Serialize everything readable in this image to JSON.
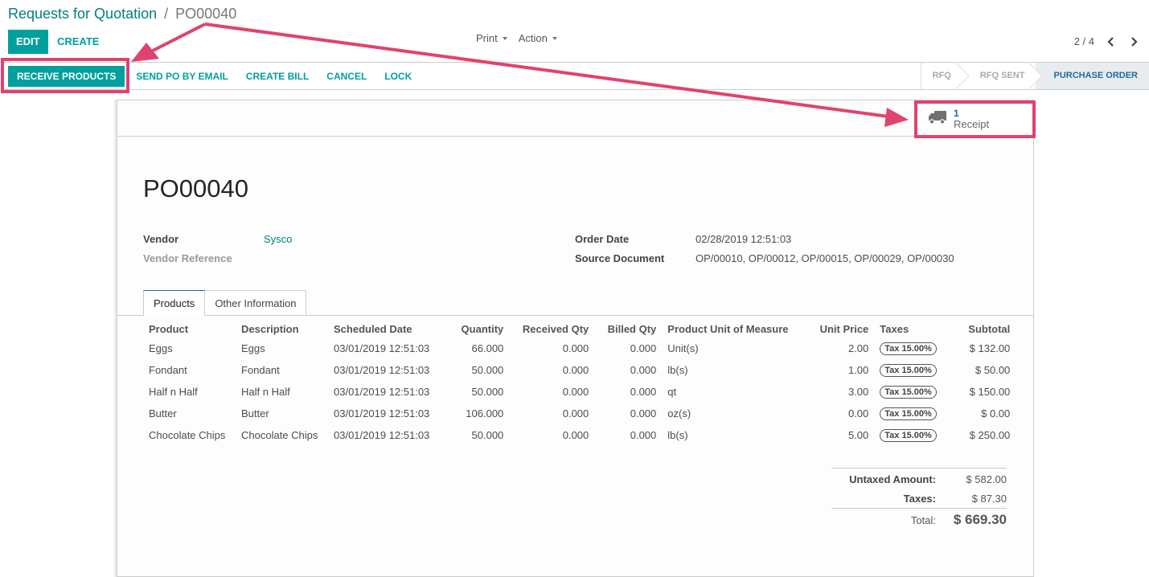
{
  "breadcrumb": {
    "parent": "Requests for Quotation",
    "separator": "/",
    "current": "PO00040"
  },
  "control_panel": {
    "edit_label": "EDIT",
    "create_label": "CREATE",
    "print_label": "Print",
    "action_label": "Action",
    "pager": {
      "value": "2 / 4"
    }
  },
  "statusbar": {
    "buttons": [
      "RECEIVE PRODUCTS",
      "SEND PO BY EMAIL",
      "CREATE BILL",
      "CANCEL",
      "LOCK"
    ],
    "stages": [
      {
        "label": "RFQ",
        "active": false
      },
      {
        "label": "RFQ SENT",
        "active": false
      },
      {
        "label": "PURCHASE ORDER",
        "active": true
      }
    ]
  },
  "smart_button": {
    "icon": "truck-icon",
    "count": "1",
    "label": "Receipt"
  },
  "form": {
    "title": "PO00040",
    "left_fields": [
      {
        "label": "Vendor",
        "value": "Sysco"
      },
      {
        "label": "Vendor Reference",
        "value": ""
      }
    ],
    "right_fields": [
      {
        "label": "Order Date",
        "value": "02/28/2019 12:51:03"
      },
      {
        "label": "Source Document",
        "value": "OP/00010, OP/00012, OP/00015, OP/00029, OP/00030"
      }
    ],
    "tabs": [
      "Products",
      "Other Information"
    ]
  },
  "lines": {
    "headers": [
      "Product",
      "Description",
      "Scheduled Date",
      "Quantity",
      "Received Qty",
      "Billed Qty",
      "Product Unit of Measure",
      "Unit Price",
      "Taxes",
      "Subtotal"
    ],
    "rows": [
      [
        "Eggs",
        "Eggs",
        "03/01/2019 12:51:03",
        "66.000",
        "0.000",
        "0.000",
        "Unit(s)",
        "2.00",
        "Tax 15.00%",
        "$ 132.00"
      ],
      [
        "Fondant",
        "Fondant",
        "03/01/2019 12:51:03",
        "50.000",
        "0.000",
        "0.000",
        "lb(s)",
        "1.00",
        "Tax 15.00%",
        "$ 50.00"
      ],
      [
        "Half n Half",
        "Half n Half",
        "03/01/2019 12:51:03",
        "50.000",
        "0.000",
        "0.000",
        "qt",
        "3.00",
        "Tax 15.00%",
        "$ 150.00"
      ],
      [
        "Butter",
        "Butter",
        "03/01/2019 12:51:03",
        "106.000",
        "0.000",
        "0.000",
        "oz(s)",
        "0.00",
        "Tax 15.00%",
        "$ 0.00"
      ],
      [
        "Chocolate Chips",
        "Chocolate Chips",
        "03/01/2019 12:51:03",
        "50.000",
        "0.000",
        "0.000",
        "lb(s)",
        "5.00",
        "Tax 15.00%",
        "$ 250.00"
      ]
    ]
  },
  "totals": {
    "untaxed_label": "Untaxed Amount:",
    "untaxed_value": "$ 582.00",
    "taxes_label": "Taxes:",
    "taxes_value": "$ 87.30",
    "total_label": "Total:",
    "total_value": "$ 669.30"
  },
  "annotation": {
    "color": "#e0436d"
  },
  "colors": {
    "primary": "#00a09d",
    "link": "#00807a",
    "stage_active": "#1f6b96"
  }
}
